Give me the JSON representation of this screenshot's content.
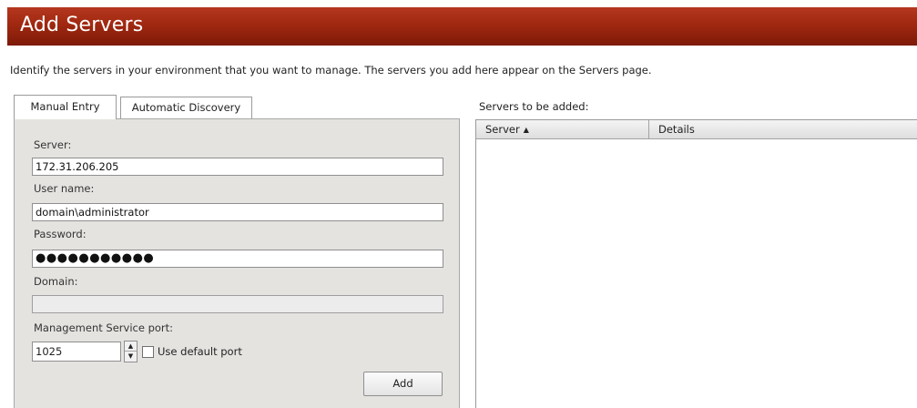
{
  "header": {
    "title": "Add Servers"
  },
  "intro": "Identify the servers in your environment that you want to manage. The servers you add here appear on the Servers page.",
  "tabs": [
    {
      "label": "Manual Entry",
      "active": true
    },
    {
      "label": "Automatic Discovery",
      "active": false
    }
  ],
  "form": {
    "server_label": "Server:",
    "server_value": "172.31.206.205",
    "username_label": "User name:",
    "username_value": "domain\\administrator",
    "password_label": "Password:",
    "password_value": "●●●●●●●●●●●",
    "domain_label": "Domain:",
    "domain_value": "",
    "port_label": "Management Service port:",
    "port_value": "1025",
    "default_port_label": "Use default port",
    "default_port_checked": false,
    "add_label": "Add"
  },
  "servers_list": {
    "label": "Servers to be added:",
    "columns": [
      {
        "label": "Server",
        "sort": "ascending"
      },
      {
        "label": "Details"
      }
    ],
    "rows": []
  },
  "colors": {
    "title_bar_top": "#b5371f",
    "title_bar_bottom": "#7d1a08",
    "panel_bg": "#e4e3e0"
  }
}
